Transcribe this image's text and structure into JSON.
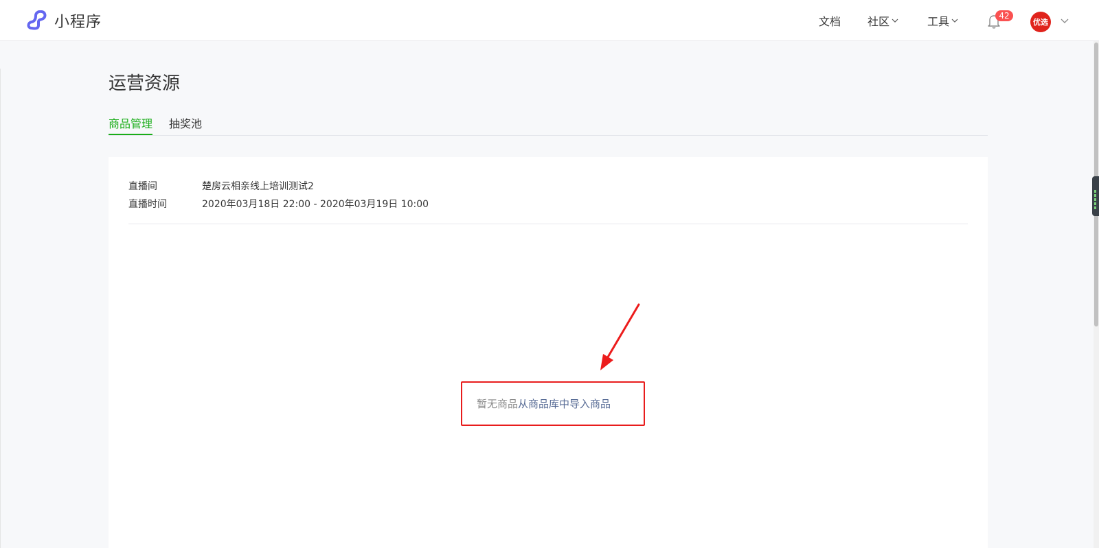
{
  "header": {
    "app_name": "小程序",
    "nav": {
      "docs": "文档",
      "community": "社区",
      "tools": "工具"
    },
    "notification_count": "42",
    "avatar_text": "优选",
    "brand_color": "#6467f0"
  },
  "page": {
    "title": "运营资源",
    "tabs": [
      {
        "label": "商品管理",
        "active": true
      },
      {
        "label": "抽奖池",
        "active": false
      }
    ],
    "accent_color": "#1aad19"
  },
  "live_info": {
    "room_label": "直播间",
    "room_value": "楚房云相亲线上培训测试2",
    "time_label": "直播时间",
    "time_value": "2020年03月18日 22:00 - 2020年03月19日 10:00"
  },
  "empty_state": {
    "text": "暂无商品",
    "link": "从商品库中导入商品",
    "highlight_color": "#e81c1c"
  }
}
